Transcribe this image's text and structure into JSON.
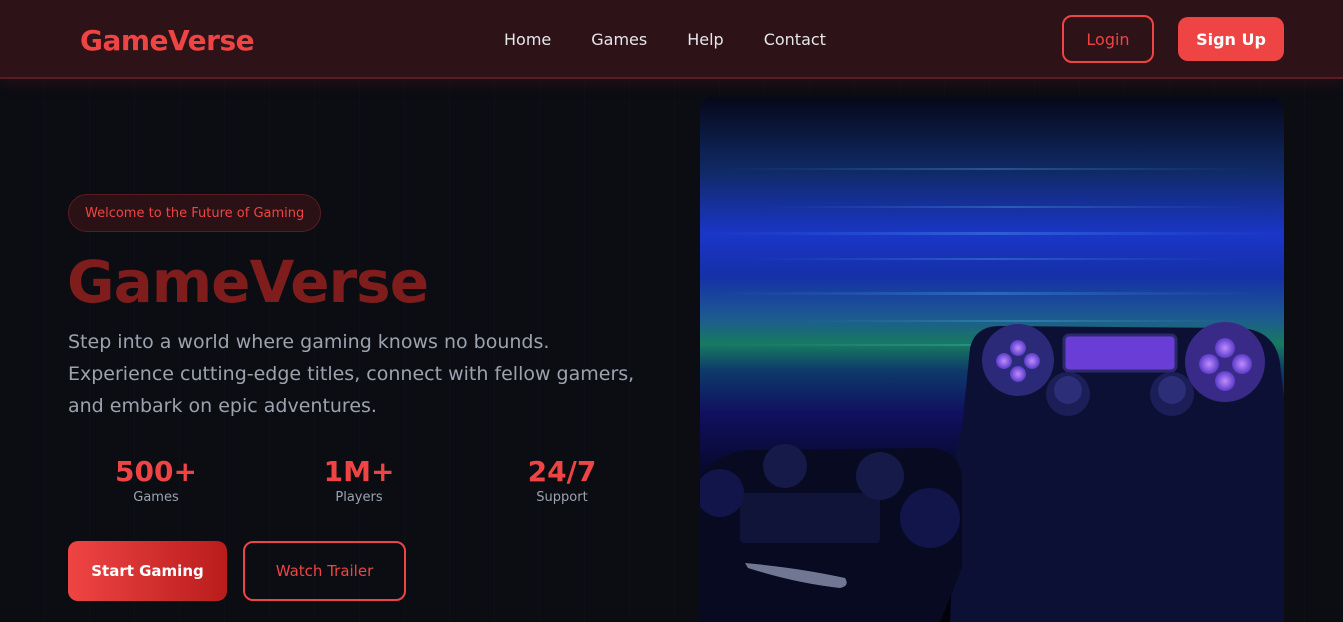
{
  "brand": {
    "logo": "GameVerse"
  },
  "nav": {
    "links": [
      "Home",
      "Games",
      "Help",
      "Contact"
    ],
    "login_label": "Login",
    "signup_label": "Sign Up"
  },
  "hero": {
    "badge": "Welcome to the Future of Gaming",
    "title": "GameVerse",
    "description": "Step into a world where gaming knows no bounds. Experience cutting-edge titles, connect with fellow gamers, and embark on epic adventures.",
    "stats": [
      {
        "value": "500+",
        "label": "Games"
      },
      {
        "value": "1M+",
        "label": "Players"
      },
      {
        "value": "24/7",
        "label": "Support"
      }
    ],
    "start_label": "Start Gaming",
    "trailer_label": "Watch Trailer"
  },
  "colors": {
    "accent": "#ef4444",
    "nav_bg": "#2d1217",
    "page_bg": "#0b0d13"
  }
}
